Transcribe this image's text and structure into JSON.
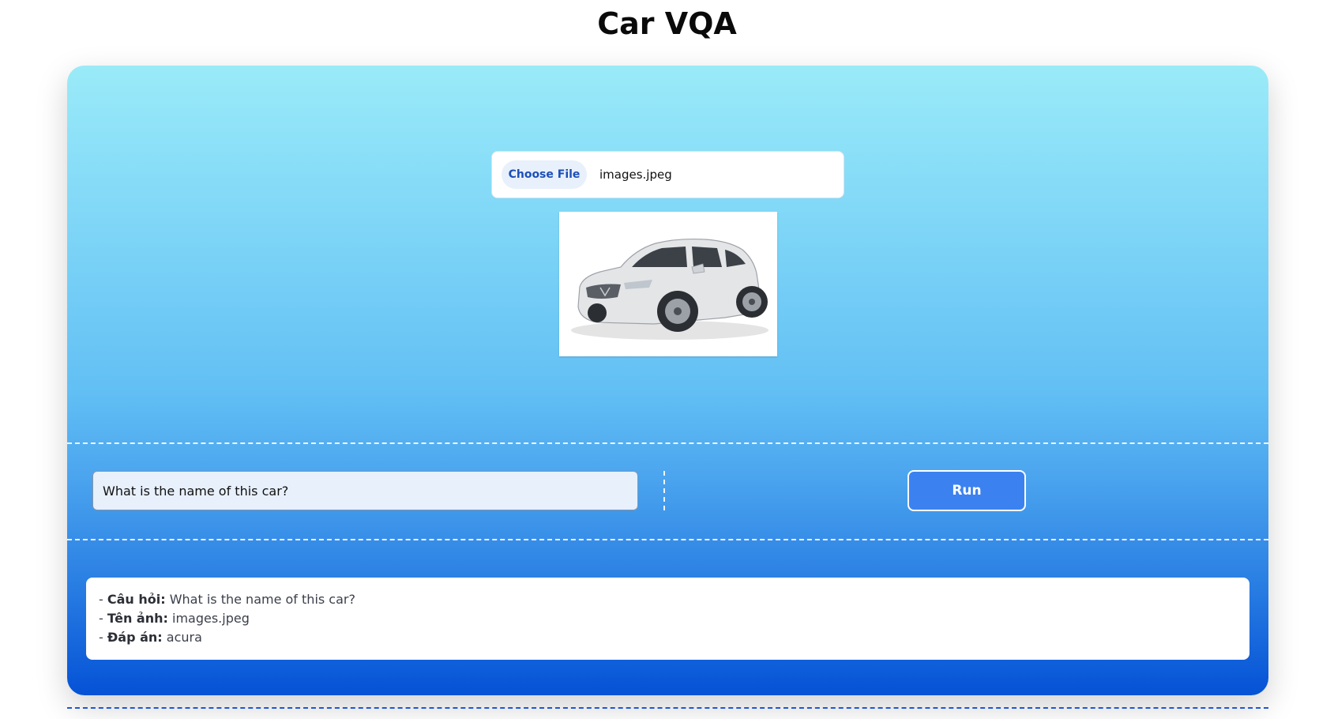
{
  "page": {
    "title": "Car VQA"
  },
  "upload": {
    "choose_label": "Choose File",
    "file_name": "images.jpeg"
  },
  "preview": {
    "icon": "car-image"
  },
  "question": {
    "value": "What is the name of this car?"
  },
  "run": {
    "label": "Run"
  },
  "result": {
    "lines": [
      {
        "prefix": "- ",
        "label": "Câu hỏi:",
        "value": "What is the name of this car?"
      },
      {
        "prefix": "- ",
        "label": "Tên ảnh:",
        "value": "images.jpeg"
      },
      {
        "prefix": "- ",
        "label": "Đáp án:",
        "value": "acura"
      }
    ]
  },
  "colors": {
    "panel_top": "#9aebf8",
    "panel_bottom": "#0552d6",
    "run_button": "#3b82f0"
  }
}
